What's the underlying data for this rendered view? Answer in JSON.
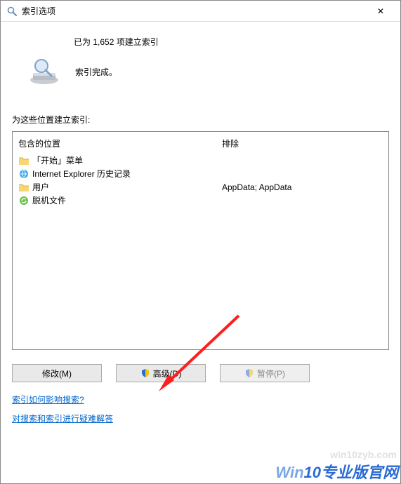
{
  "window": {
    "title": "索引选项",
    "close_symbol": "✕"
  },
  "status": {
    "count_line": "已为 1,652 项建立索引",
    "done_line": "索引完成。"
  },
  "section_label": "为这些位置建立索引:",
  "columns": {
    "included_header": "包含的位置",
    "excluded_header": "排除"
  },
  "locations": [
    {
      "name": "「开始」菜单",
      "excluded": ""
    },
    {
      "name": "Internet Explorer 历史记录",
      "excluded": ""
    },
    {
      "name": "用户",
      "excluded": "AppData; AppData"
    },
    {
      "name": "脱机文件",
      "excluded": ""
    }
  ],
  "buttons": {
    "modify": "修改(M)",
    "advanced": "高级(D)",
    "pause": "暂停(P)"
  },
  "links": {
    "how_affects": "索引如何影响搜索?",
    "troubleshoot": "对搜索和索引进行疑难解答"
  },
  "watermark": {
    "url": "win10zyb.com",
    "brand_a": "Win",
    "brand_b": "10专业版官网"
  }
}
